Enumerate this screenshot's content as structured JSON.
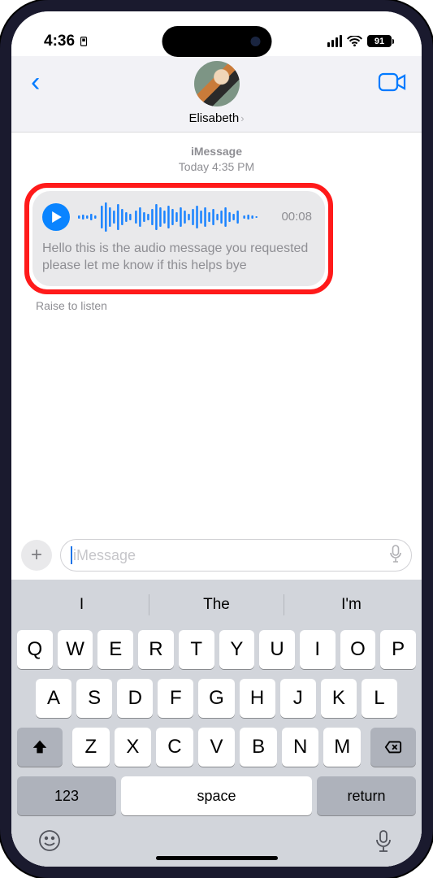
{
  "status": {
    "time": "4:36",
    "battery": "91"
  },
  "header": {
    "contact": "Elisabeth"
  },
  "thread": {
    "service": "iMessage",
    "timestamp": "Today 4:35 PM",
    "audio": {
      "duration": "00:08",
      "transcript": "Hello this is the audio message you requested please let me know if this helps bye"
    },
    "hint": "Raise to listen"
  },
  "compose": {
    "placeholder": "iMessage"
  },
  "suggestions": [
    "I",
    "The",
    "I'm"
  ],
  "keyboard": {
    "row1": [
      "Q",
      "W",
      "E",
      "R",
      "T",
      "Y",
      "U",
      "I",
      "O",
      "P"
    ],
    "row2": [
      "A",
      "S",
      "D",
      "F",
      "G",
      "H",
      "J",
      "K",
      "L"
    ],
    "row3": [
      "Z",
      "X",
      "C",
      "V",
      "B",
      "N",
      "M"
    ],
    "numKey": "123",
    "space": "space",
    "return": "return"
  }
}
